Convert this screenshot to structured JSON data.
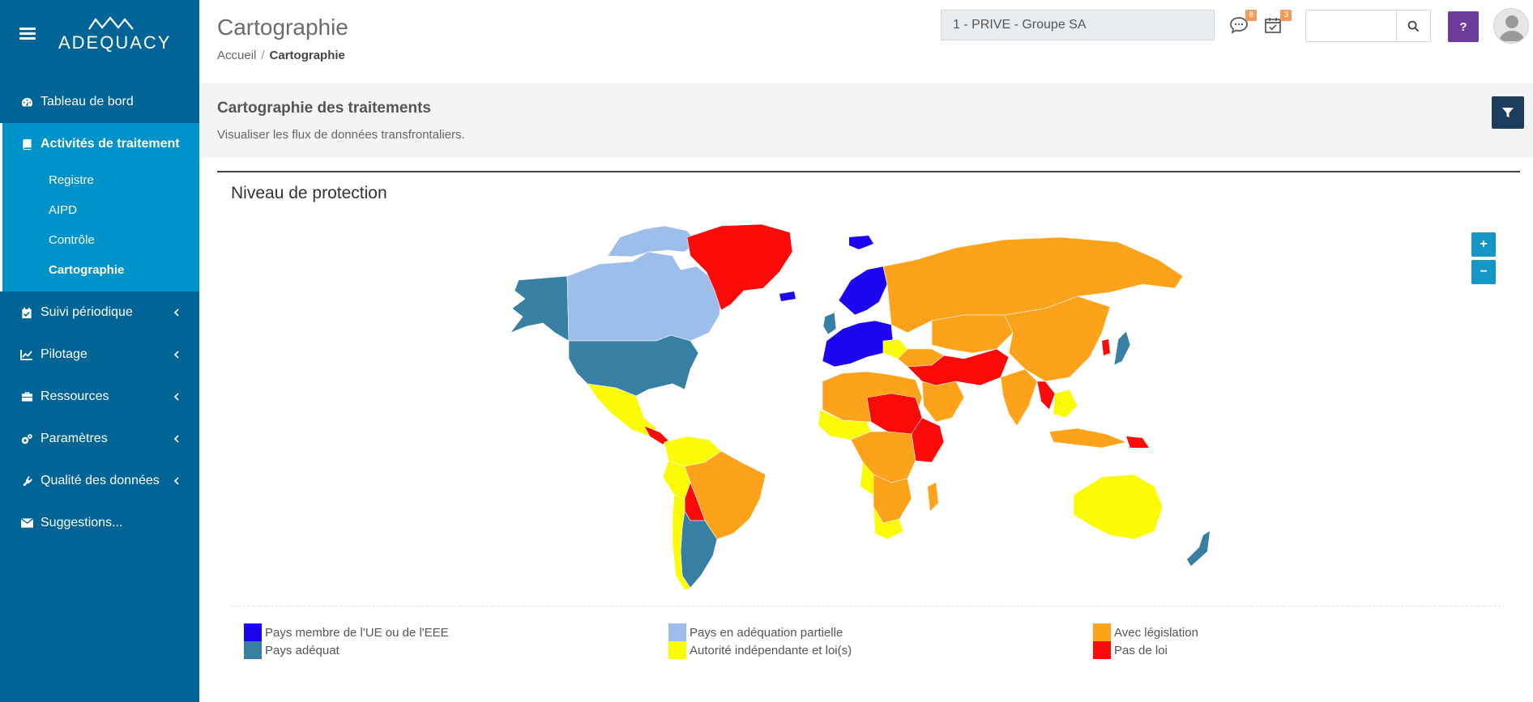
{
  "brand": {
    "name": "ADEQUACY"
  },
  "sidebar": {
    "items": [
      {
        "label": "Tableau de bord",
        "icon": "dashboard-icon"
      },
      {
        "label": "Activités de traitement",
        "icon": "book-icon",
        "children": [
          "Registre",
          "AIPD",
          "Contrôle",
          "Cartographie"
        ],
        "current_child": "Cartographie"
      },
      {
        "label": "Suivi périodique",
        "icon": "calendar-check-icon"
      },
      {
        "label": "Pilotage",
        "icon": "line-chart-icon"
      },
      {
        "label": "Ressources",
        "icon": "briefcase-icon"
      },
      {
        "label": "Paramètres",
        "icon": "cogs-icon"
      },
      {
        "label": "Qualité des données",
        "icon": "plug-icon"
      },
      {
        "label": "Suggestions...",
        "icon": "envelope-icon"
      }
    ]
  },
  "header": {
    "title": "Cartographie",
    "breadcrumb": [
      "Accueil",
      "Cartographie"
    ],
    "org_select": "1 - PRIVE - Groupe SA",
    "messages_count": "8",
    "tasks_count": "3",
    "search_value": "",
    "help_label": "?"
  },
  "band": {
    "title": "Cartographie des traitements",
    "subtitle": "Visualiser les flux de données transfrontaliers."
  },
  "card": {
    "title": "Niveau de protection",
    "zoom_in": "+",
    "zoom_out": "−"
  },
  "colors": {
    "ue": "#1c05f0",
    "partial": "#9dbdea",
    "legislation": "#fda21b",
    "adequate": "#377fa3",
    "authority": "#fbfb06",
    "nolaw": "#fb0a0a",
    "sidebar": "#016497",
    "sidebar_active": "#0093c9"
  },
  "legend": [
    {
      "label": "Pays membre de l'UE ou de l'EEE",
      "color": "#1c05f0"
    },
    {
      "label": "Pays adéquat",
      "color": "#377fa3"
    },
    {
      "label": "Pays en adéquation partielle",
      "color": "#9dbdea"
    },
    {
      "label": "Autorité indépendante et loi(s)",
      "color": "#fbfb06"
    },
    {
      "label": "Avec législation",
      "color": "#fda21b"
    },
    {
      "label": "Pas de loi",
      "color": "#fb0a0a"
    }
  ]
}
